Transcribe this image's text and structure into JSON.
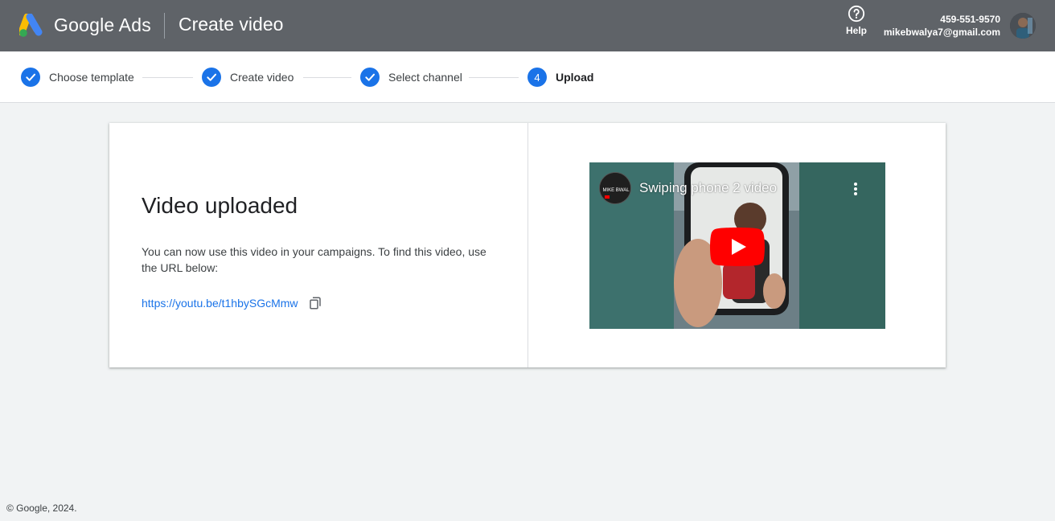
{
  "header": {
    "brand": "Google Ads",
    "page_title": "Create video",
    "help_label": "Help",
    "account_id": "459-551-9570",
    "account_email": "mikebwalya7@gmail.com"
  },
  "stepper": {
    "steps": [
      {
        "label": "Choose template",
        "state": "done"
      },
      {
        "label": "Create video",
        "state": "done"
      },
      {
        "label": "Select channel",
        "state": "done"
      },
      {
        "label": "Upload",
        "number": "4",
        "state": "active"
      }
    ]
  },
  "card": {
    "title": "Video uploaded",
    "description": "You can now use this video in your campaigns. To find this video, use the URL below:",
    "url": "https://youtu.be/t1hbySGcMmw"
  },
  "video": {
    "title": "Swiping phone 2 video",
    "channel_avatar_text": "MIKE BWAL"
  },
  "footer": {
    "copyright": "© Google, 2024."
  },
  "colors": {
    "header_bg": "#5f6368",
    "accent": "#1a73e8",
    "page_bg": "#f1f3f4",
    "youtube_red": "#ff0000"
  }
}
